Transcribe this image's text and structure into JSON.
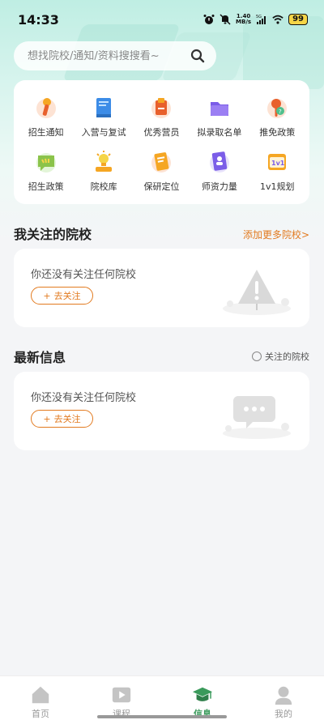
{
  "status": {
    "time": "14:33",
    "net_speed": "1.40",
    "net_unit": "MB/s",
    "signal": "5G",
    "battery": "99"
  },
  "search": {
    "placeholder": "想找院校/通知/资料搜搜看~"
  },
  "shortcuts": [
    {
      "label": "招生通知",
      "icon": "microphone-icon"
    },
    {
      "label": "入营与复试",
      "icon": "book-icon"
    },
    {
      "label": "优秀营员",
      "icon": "medal-card-icon"
    },
    {
      "label": "拟录取名单",
      "icon": "folder-icon"
    },
    {
      "label": "推免政策",
      "icon": "magnifier-icon"
    },
    {
      "label": "招生政策",
      "icon": "chat-bubble-icon"
    },
    {
      "label": "院校库",
      "icon": "lightbulb-icon"
    },
    {
      "label": "保研定位",
      "icon": "notebook-icon"
    },
    {
      "label": "师资力量",
      "icon": "profile-card-icon"
    },
    {
      "label": "1v1规划",
      "icon": "calendar-1v1-icon"
    }
  ],
  "my_schools": {
    "title": "我关注的院校",
    "add_link": "添加更多院校>",
    "empty_text": "你还没有关注任何院校",
    "follow_btn": "去关注"
  },
  "latest": {
    "title": "最新信息",
    "filter_label": "关注的院校",
    "empty_text": "你还没有关注任何院校",
    "follow_btn": "去关注"
  },
  "tabs": [
    {
      "label": "首页",
      "icon": "home-icon",
      "active": false
    },
    {
      "label": "课程",
      "icon": "video-icon",
      "active": false
    },
    {
      "label": "信息",
      "icon": "graduation-cap-icon",
      "active": true
    },
    {
      "label": "我的",
      "icon": "person-icon",
      "active": false
    }
  ],
  "colors": {
    "accent": "#e27a1f",
    "active_tab": "#3a9a5b",
    "header_bg": "#bfeee3"
  }
}
